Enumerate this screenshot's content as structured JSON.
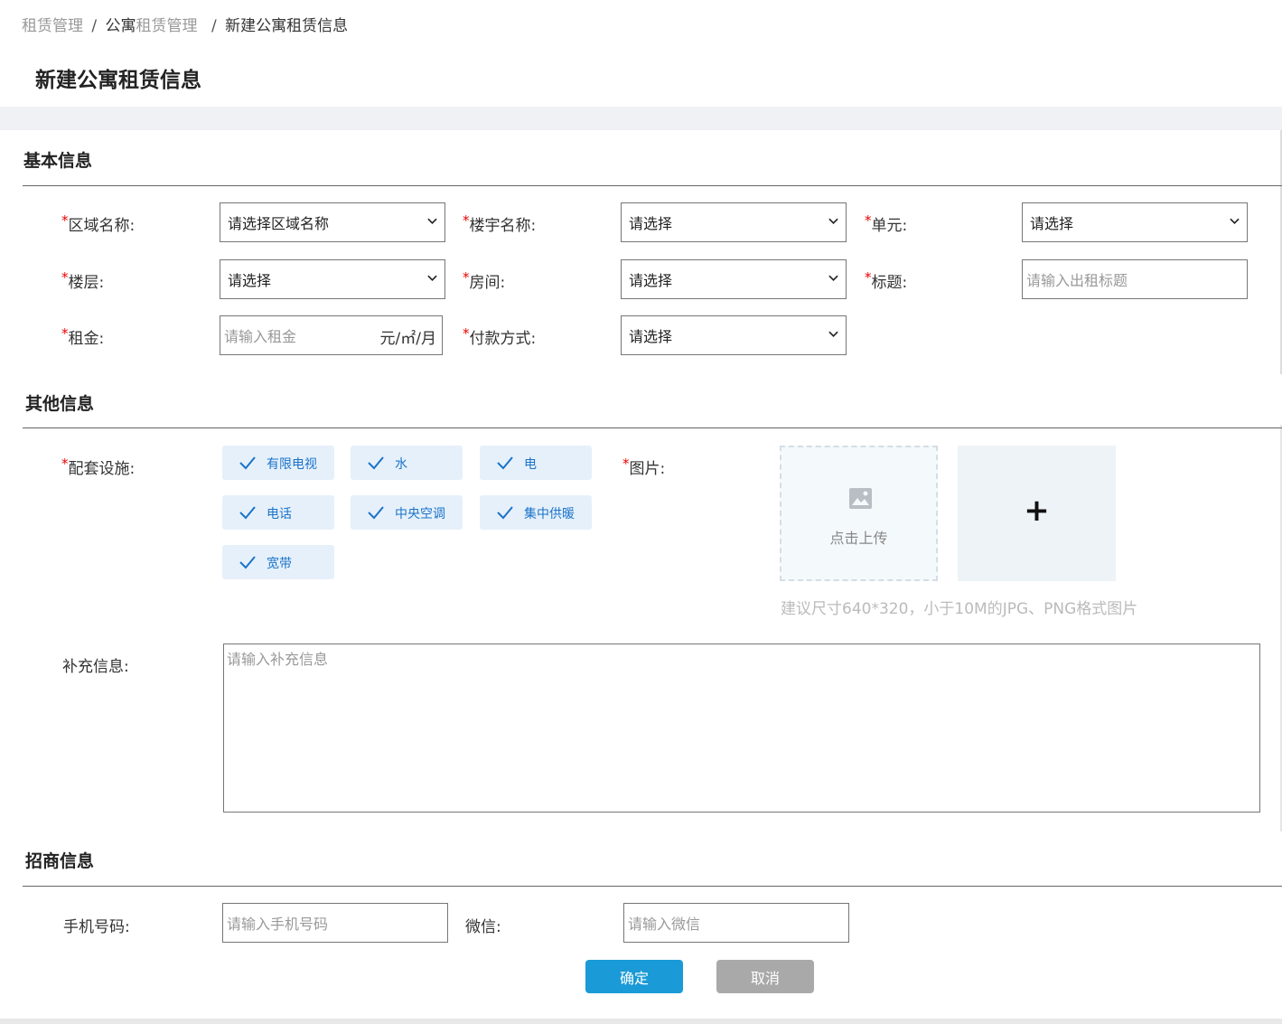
{
  "breadcrumb": {
    "item1": "租赁管理",
    "sep1": "/",
    "item2_part1": "公寓",
    "item2_part2": "租赁管理",
    "sep2": "/",
    "item3": "新建公寓租赁信息"
  },
  "page_title": "新建公寓租赁信息",
  "sections": {
    "basic": "基本信息",
    "other": "其他信息",
    "merchant": "招商信息"
  },
  "required_mark": "*",
  "basic": {
    "area_label": "区域名称:",
    "area_value": "请选择区域名称",
    "building_label": "楼宇名称:",
    "building_value": "请选择",
    "unit_label": "单元:",
    "unit_value": "请选择",
    "floor_label": "楼层:",
    "floor_value": "请选择",
    "room_label": "房间:",
    "room_value": "请选择",
    "title_label": "标题:",
    "title_placeholder": "请输入出租标题",
    "rent_label": "租金:",
    "rent_placeholder": "请输入租金",
    "rent_unit": "元/㎡/月",
    "payment_label": "付款方式:",
    "payment_value": "请选择"
  },
  "other": {
    "facilities_label": "配套设施:",
    "facilities": [
      "有限电视",
      "水",
      "电",
      "电话",
      "中央空调",
      "集中供暖",
      "宽带"
    ],
    "images_label": "图片:",
    "upload_text": "点击上传",
    "add_symbol": "+",
    "image_hint": "建议尺寸640*320，小于10M的JPG、PNG格式图片",
    "extra_label": "补充信息:",
    "extra_placeholder": "请输入补充信息"
  },
  "merchant": {
    "phone_label": "手机号码:",
    "phone_placeholder": "请输入手机号码",
    "wechat_label": "微信:",
    "wechat_placeholder": "请输入微信"
  },
  "buttons": {
    "ok": "确定",
    "cancel": "取消"
  },
  "colors": {
    "primary": "#1a9ad6",
    "cancel": "#a9a9a9",
    "chip_bg": "#e6f0fb",
    "chip_text": "#1a73c9",
    "required": "#ee0000"
  }
}
